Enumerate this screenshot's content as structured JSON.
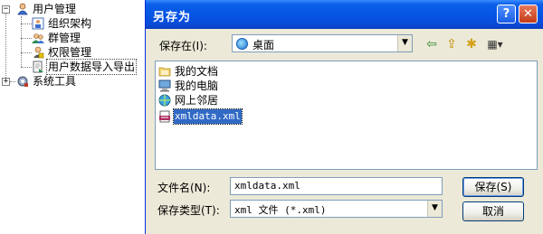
{
  "tree": {
    "root_label": "用户管理",
    "children": [
      "组织架构",
      "群管理",
      "权限管理",
      "用户数据导入导出"
    ],
    "sibling_label": "系统工具",
    "expander_open": "−",
    "expander_closed": "+"
  },
  "dialog": {
    "title": "另存为",
    "help_label": "?",
    "close_label": "✕",
    "lookin_label": "保存在(I):",
    "lookin_value": "桌面",
    "toolbar": {
      "back_icon": "⇦",
      "up_icon": "⇪",
      "newfolder_icon": "✱",
      "view_icon": "▦▾"
    },
    "files": [
      {
        "name": "我的文档",
        "icon": "folder-icon"
      },
      {
        "name": "我的电脑",
        "icon": "computer-icon"
      },
      {
        "name": "网上邻居",
        "icon": "network-icon"
      },
      {
        "name": "xmldata.xml",
        "icon": "xml-file-icon"
      }
    ],
    "filename_label": "文件名(N):",
    "filename_value": "xmldata.xml",
    "filetype_label": "保存类型(T):",
    "filetype_value": "xml 文件 (*.xml)",
    "save_button": "保存(S)",
    "cancel_button": "取消",
    "dropdown_arrow": "▼"
  }
}
